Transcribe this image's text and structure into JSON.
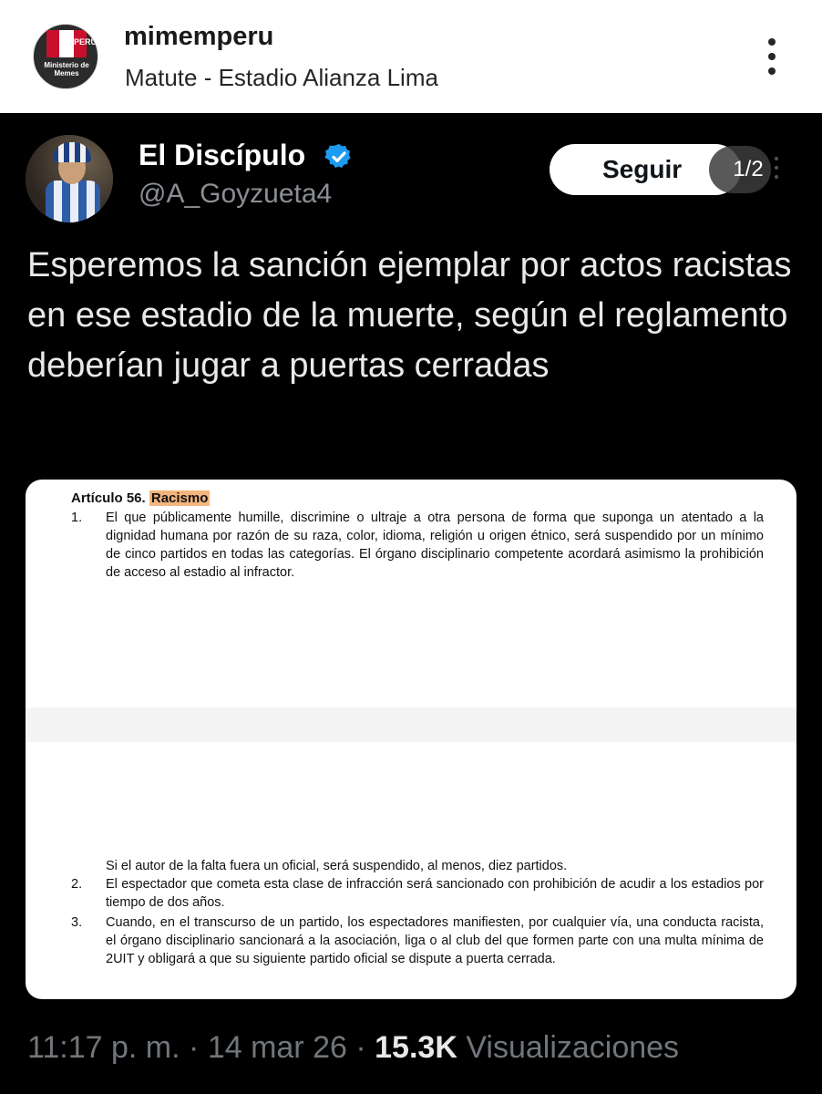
{
  "instagram": {
    "username": "mimemperu",
    "location": "Matute - Estadio Alianza Lima",
    "avatar_text": {
      "country": "PERÚ",
      "name": "Ministerio de Memes"
    },
    "more_icon": "vertical-ellipsis-icon"
  },
  "tweet": {
    "author_name": "El Discípulo",
    "verified": true,
    "handle": "@A_Goyzueta4",
    "follow_label": "Seguir",
    "pager": "1/2",
    "text": "Esperemos la sanción ejemplar por actos racistas en ese estadio de la muerte, según el reglamento deberían jugar a puertas cerradas",
    "time": "11:17 p. m.",
    "sep1": "·",
    "date": "14 mar 26",
    "sep2": "·",
    "views": "15.3K",
    "views_label": "Visualizaciones",
    "colors": {
      "background": "#000000",
      "verified": "#1d9bf0",
      "secondary": "#71767b",
      "highlight": "#f3b57e"
    }
  },
  "document": {
    "title_prefix": "Artículo 56.",
    "title_highlight": "Racismo",
    "items": [
      {
        "num": "1.",
        "text": "El que públicamente humille, discrimine o ultraje a otra persona de forma que suponga un atentado a la dignidad humana por razón de su raza, color, idioma, religión u origen étnico, será suspendido por un mínimo de cinco partidos en todas las categorías. El órgano disciplinario competente acordará asimismo la prohibición de acceso al estadio al infractor."
      },
      {
        "num": "",
        "text": "Si el autor de la falta fuera un oficial, será suspendido, al menos, diez partidos."
      },
      {
        "num": "2.",
        "text": "El espectador que cometa esta clase de infracción será sancionado con prohibición de acudir a los estadios por tiempo de dos años."
      },
      {
        "num": "3.",
        "text": "Cuando, en el transcurso de un partido, los espectadores manifiesten, por cualquier vía, una conducta racista, el órgano disciplinario sancionará a la asociación, liga o al club del que formen parte con una multa mínima de 2UIT y obligará a que su siguiente partido oficial se dispute a puerta cerrada."
      }
    ]
  }
}
